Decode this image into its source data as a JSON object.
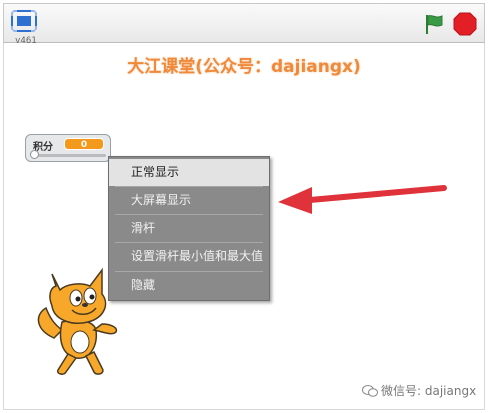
{
  "window": {
    "version": "v461",
    "title": "大江课堂(公众号：dajiangx)"
  },
  "monitor": {
    "name": "积分",
    "value": "0"
  },
  "context_menu": {
    "items": [
      {
        "label": "正常显示"
      },
      {
        "label": "大屏幕显示"
      },
      {
        "label": "滑杆"
      },
      {
        "label": "设置滑杆最小值和最大值"
      },
      {
        "label": "隐藏"
      }
    ]
  },
  "watermark": {
    "text": "微信号: dajiangx"
  },
  "colors": {
    "title": "#f08a3a",
    "arrow": "#e0323a",
    "var_value": "#f39a1d",
    "stop": "#e31e24",
    "flag": "#3a9b46"
  }
}
